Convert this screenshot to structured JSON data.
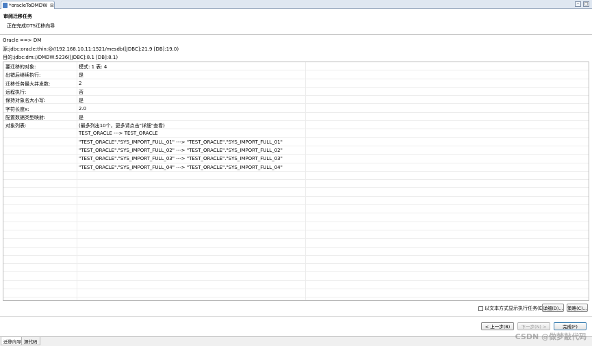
{
  "editor_tab": {
    "title": "*oracleToDMDW",
    "close_glyph": "⊠"
  },
  "window_controls": {
    "minimize": "–",
    "maximize": "□"
  },
  "wizard": {
    "title": "审阅迁移任务",
    "subtitle": "正在完成DTS迁移向导"
  },
  "info": {
    "direction": "Oracle ==> DM",
    "source": "源:jdbc:oracle:thin:@//192.168.10.11:1521/mesdb([JDBC]:21.9 [DB]:19.0)",
    "target": "目的:jdbc:dm://DMDW:5236([JDBC]:8.1 [DB]:8.1)"
  },
  "properties": [
    {
      "label": "要迁移的对象:",
      "value": "模式: 1 表: 4"
    },
    {
      "label": "出错后继续执行:",
      "value": "是"
    },
    {
      "label": "迁移任务最大并发数:",
      "value": "2"
    },
    {
      "label": "远程执行:",
      "value": "否"
    },
    {
      "label": "保持对象名大小写:",
      "value": "是"
    },
    {
      "label": "字符长度x:",
      "value": "2.0"
    },
    {
      "label": "配置数据类型映射:",
      "value": "是"
    },
    {
      "label": "对象列表:",
      "value": "(最多列出10个，更多请点击\"详细\"查看)"
    },
    {
      "label": "",
      "value": "TEST_ORACLE ---> TEST_ORACLE"
    },
    {
      "label": "",
      "value": "\"TEST_ORACLE\".\"SYS_IMPORT_FULL_01\" ---> \"TEST_ORACLE\".\"SYS_IMPORT_FULL_01\""
    },
    {
      "label": "",
      "value": "\"TEST_ORACLE\".\"SYS_IMPORT_FULL_02\" ---> \"TEST_ORACLE\".\"SYS_IMPORT_FULL_02\""
    },
    {
      "label": "",
      "value": "\"TEST_ORACLE\".\"SYS_IMPORT_FULL_03\" ---> \"TEST_ORACLE\".\"SYS_IMPORT_FULL_03\""
    },
    {
      "label": "",
      "value": "\"TEST_ORACLE\".\"SYS_IMPORT_FULL_04\" ---> \"TEST_ORACLE\".\"SYS_IMPORT_FULL_04\""
    }
  ],
  "options": {
    "show_text_label": "以文本方式显示执行任务(E)",
    "checked": false
  },
  "buttons": {
    "details": "详细(D)...",
    "strategy": "策略(C)...",
    "back": "< 上一步(B)",
    "next": "下一步(N) >",
    "finish": "完成(F)"
  },
  "bottom_tabs": [
    "迁移向导",
    "源代码"
  ],
  "watermark": "CSDN @做梦敲代码"
}
